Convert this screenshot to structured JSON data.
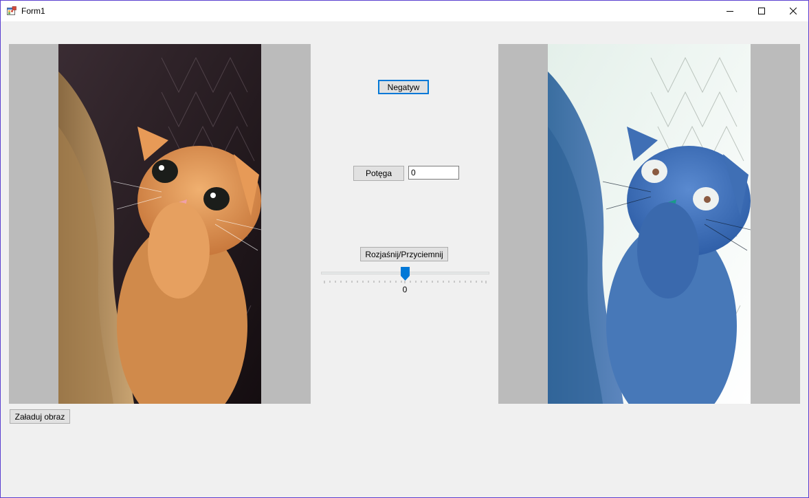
{
  "window": {
    "title": "Form1"
  },
  "buttons": {
    "negatyw": "Negatyw",
    "potega": "Potęga",
    "rozjasnij": "Rozjaśnij/Przyciemnij",
    "zaladuj": "Załaduj obraz"
  },
  "potega_input": {
    "value": "0"
  },
  "slider": {
    "value": "0",
    "position_fraction": 0.5
  },
  "images": {
    "left": "original-cat-photo",
    "right": "negative-cat-photo"
  },
  "colors": {
    "window_border": "#5a3fd0",
    "form_background": "#f0f0f0",
    "picturebox_background": "#bbbbbb",
    "accent": "#0078d7"
  }
}
